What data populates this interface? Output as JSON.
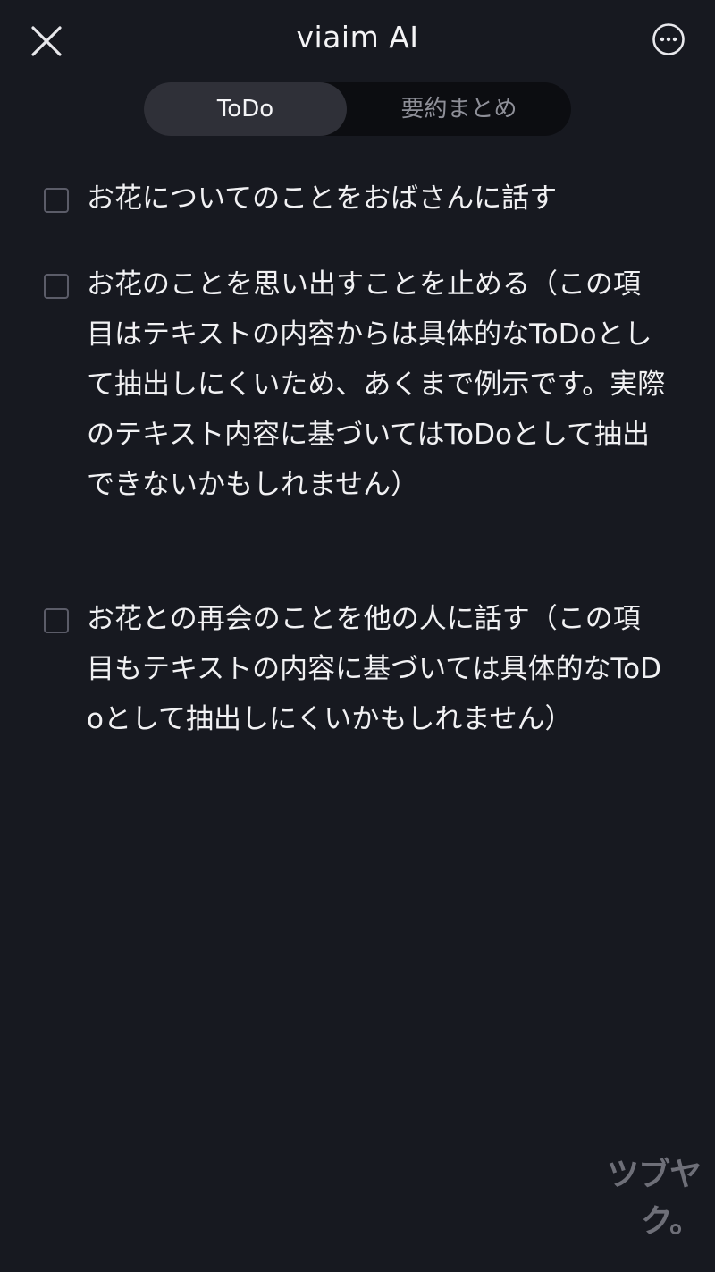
{
  "header": {
    "title": "viaim AI",
    "close_icon": "close-icon",
    "more_icon": "more-options-icon"
  },
  "tabs": [
    {
      "label": "ToDo",
      "active": true
    },
    {
      "label": "要約まとめ",
      "active": false
    }
  ],
  "todos": [
    {
      "text": "お花についてのことをおばさんに話す",
      "checked": false
    },
    {
      "text": "お花のことを思い出すことを止める（この項目はテキストの内容からは具体的なToDoとして抽出しにくいため、あくまで例示です。実際のテキスト内容に基づいてはToDoとして抽出できないかもしれません）",
      "checked": false
    },
    {
      "text": "お花との再会のことを他の人に話す（この項目もテキストの内容に基づいては具体的なToDoとして抽出しにくいかもしれません）",
      "checked": false
    }
  ],
  "watermark": "ツブヤク。",
  "colors": {
    "background": "#171920",
    "tab_active_bg": "#2f3038",
    "tab_track_bg": "#0c0d11",
    "checkbox_border": "#5b5c68"
  }
}
